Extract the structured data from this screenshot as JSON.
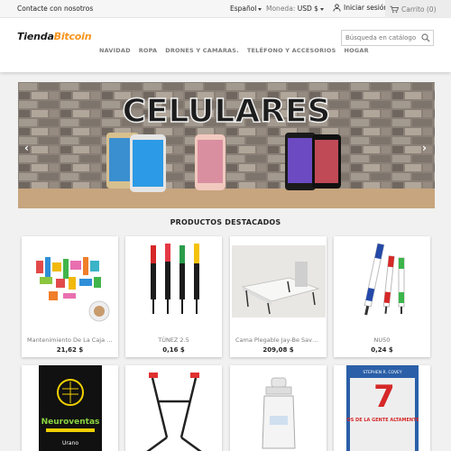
{
  "topbar": {
    "contact": "Contacte con nosotros",
    "language": "Español",
    "currency_label": "Moneda:",
    "currency_value": "USD $",
    "login": "Iniciar sesión",
    "cart": "Carrito (0)"
  },
  "header": {
    "logo_main": "Tienda",
    "logo_accent": "Bitcoin",
    "search_placeholder": "Búsqueda en catálogo",
    "nav": [
      "NAVIDAD",
      "ROPA",
      "DRONES Y CAMARAS.",
      "TELÉFONO Y ACCESORIOS",
      "HOGAR"
    ]
  },
  "banner": {
    "title": "CELULARES",
    "prev": "‹",
    "next": "›"
  },
  "featured": {
    "title": "PRODUCTOS DESTACADOS",
    "products": [
      {
        "name": "Mantenimiento De La Caja De...",
        "price": "21,62 $"
      },
      {
        "name": "TÚNEZ 2.5",
        "price": "0,16 $"
      },
      {
        "name": "Cama Plegable Jay-Be Saver...",
        "price": "209,08 $"
      },
      {
        "name": "NU50",
        "price": "0,24 $"
      },
      {
        "name": "",
        "price": ""
      },
      {
        "name": "",
        "price": ""
      },
      {
        "name": "",
        "price": ""
      },
      {
        "name": "",
        "price": ""
      }
    ],
    "book1_title": "Neuroventas",
    "book1_publisher": "Urano",
    "book2_author": "STEPHEN R. COVEY",
    "book2_title_num": "7",
    "book2_title": "LOS HÁBITOS DE LA GENTE ALTAMENTE EFECTIVA"
  },
  "colors": {
    "accent": "#f7931a",
    "text": "#232323",
    "muted": "#7a7a7a"
  }
}
